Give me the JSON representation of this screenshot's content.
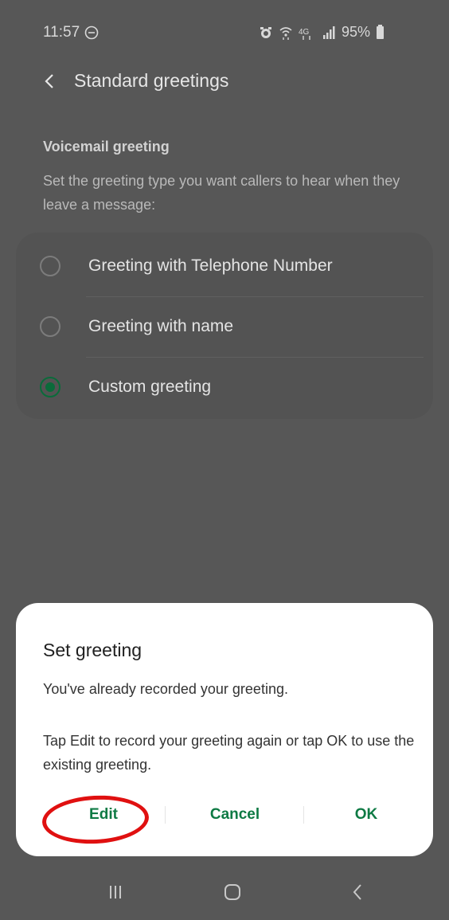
{
  "status_bar": {
    "time": "11:57",
    "right_text": "95%"
  },
  "header": {
    "title": "Standard greetings"
  },
  "section": {
    "title": "Voicemail greeting",
    "description": "Set the greeting type you want callers to hear when they leave a message:"
  },
  "options": [
    {
      "label": "Greeting with Telephone Number",
      "selected": false
    },
    {
      "label": "Greeting with name",
      "selected": false
    },
    {
      "label": "Custom greeting",
      "selected": true
    }
  ],
  "dialog": {
    "title": "Set greeting",
    "message1": "You've already recorded your greeting.",
    "message2": "Tap Edit to record your greeting again or tap OK to use the existing greeting.",
    "edit_label": "Edit",
    "cancel_label": "Cancel",
    "ok_label": "OK"
  },
  "colors": {
    "accent": "#0e7a44",
    "highlight": "#e01010",
    "overlay": "#575757"
  },
  "icons": {
    "status": [
      "minus-circle-icon",
      "alarm-icon",
      "wifi-icon",
      "4g-icon",
      "signal-icon",
      "battery-icon"
    ],
    "nav": [
      "recent-apps-icon",
      "home-icon",
      "back-icon"
    ]
  }
}
